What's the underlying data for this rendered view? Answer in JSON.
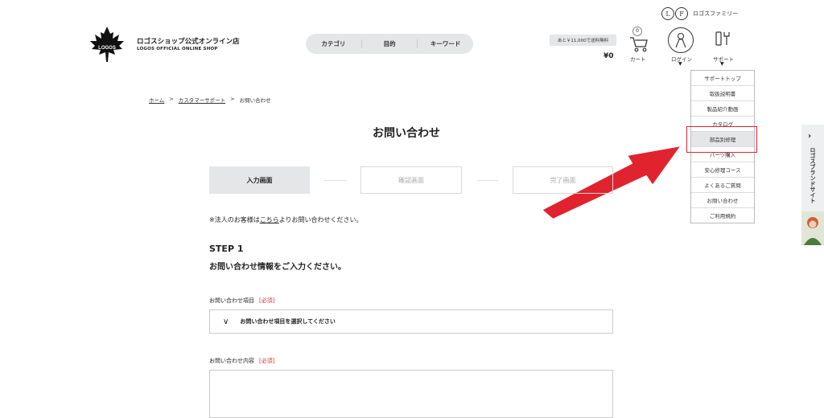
{
  "header": {
    "family_label": "ロゴスファミリー",
    "family_logo_left": "L",
    "family_logo_right": "F",
    "logo_text": "LOGOS",
    "shop_title": "ロゴスショップ公式オンライン店",
    "shop_subtitle": "LOGOS OFFICIAL ONLINE SHOP",
    "nav_tabs": [
      "カテゴリ",
      "目的",
      "キーワード"
    ],
    "shipping_note": "あと￥11,000で送料無料",
    "price": "¥0",
    "cart_count": "0",
    "cart_label": "カート",
    "login_label": "ログイン",
    "support_label": "サポート",
    "caret": "▼"
  },
  "dropdown": {
    "items": [
      "サポートトップ",
      "取扱説明書",
      "製品紹介動画",
      "カタログ",
      "部品別修理",
      "パーツ購入",
      "安心修理コース",
      "よくあるご質問",
      "お問い合わせ",
      "ご利用規約"
    ],
    "selected_index": 4
  },
  "sidetab": {
    "label": "ロゴスブランドサイト",
    "arrow": "›"
  },
  "breadcrumb": {
    "home": "ホーム",
    "sep": ">",
    "support": "カスタマーサポート",
    "current": "お問い合わせ"
  },
  "page_title": "お問い合わせ",
  "steps": [
    "入力画面",
    "確認画面",
    "完了画面"
  ],
  "active_step": 0,
  "note": {
    "prefix": "※法人のお客様は",
    "link": "こちら",
    "suffix": "よりお問い合わせください。"
  },
  "step_heading": "STEP 1",
  "step_subheading": "お問い合わせ情報をご入力ください。",
  "form": {
    "category_label": "お問い合わせ項目",
    "required": "[必須]",
    "category_placeholder": "お問い合わせ項目を選択してください",
    "chevron": "∨",
    "content_label": "お問い合わせ内容"
  },
  "colors": {
    "highlight": "#e0232e",
    "arrow": "#e0232e",
    "pill_bg": "#e4e6e8"
  }
}
